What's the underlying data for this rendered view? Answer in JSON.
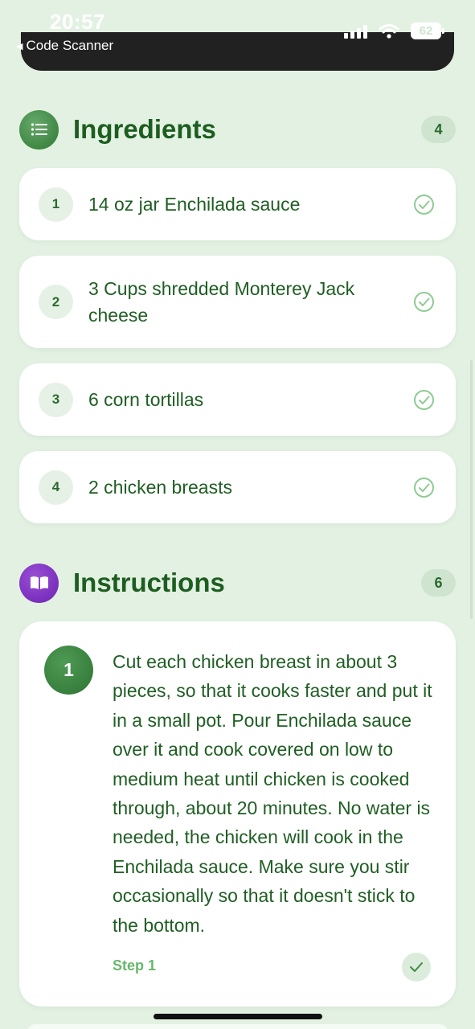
{
  "status_bar": {
    "time": "20:57",
    "back_label": "Code Scanner",
    "battery": "62"
  },
  "ingredients": {
    "title": "Ingredients",
    "count": "4",
    "icon": "list-icon",
    "items": [
      {
        "number": "1",
        "text": "14 oz jar Enchilada sauce"
      },
      {
        "number": "2",
        "text": "3 Cups shredded Monterey Jack cheese"
      },
      {
        "number": "3",
        "text": "6 corn tortillas"
      },
      {
        "number": "4",
        "text": "2 chicken breasts"
      }
    ]
  },
  "instructions": {
    "title": "Instructions",
    "count": "6",
    "icon": "book-icon",
    "steps": [
      {
        "number": "1",
        "text": "Cut each chicken breast in about 3 pieces, so that it cooks faster and put it in a small pot. Pour Enchilada sauce over it and cook covered on low to medium heat until chicken is cooked through, about 20 minutes. No water is needed, the chicken will cook in the Enchilada sauce. Make sure you stir occasionally so that it doesn't stick to the bottom.",
        "label": "Step 1"
      }
    ]
  },
  "colors": {
    "background": "#e3f1e3",
    "accent_green": "#2f7a34",
    "text_green": "#1f5e23",
    "instructions_icon": "#7b2fc0"
  }
}
